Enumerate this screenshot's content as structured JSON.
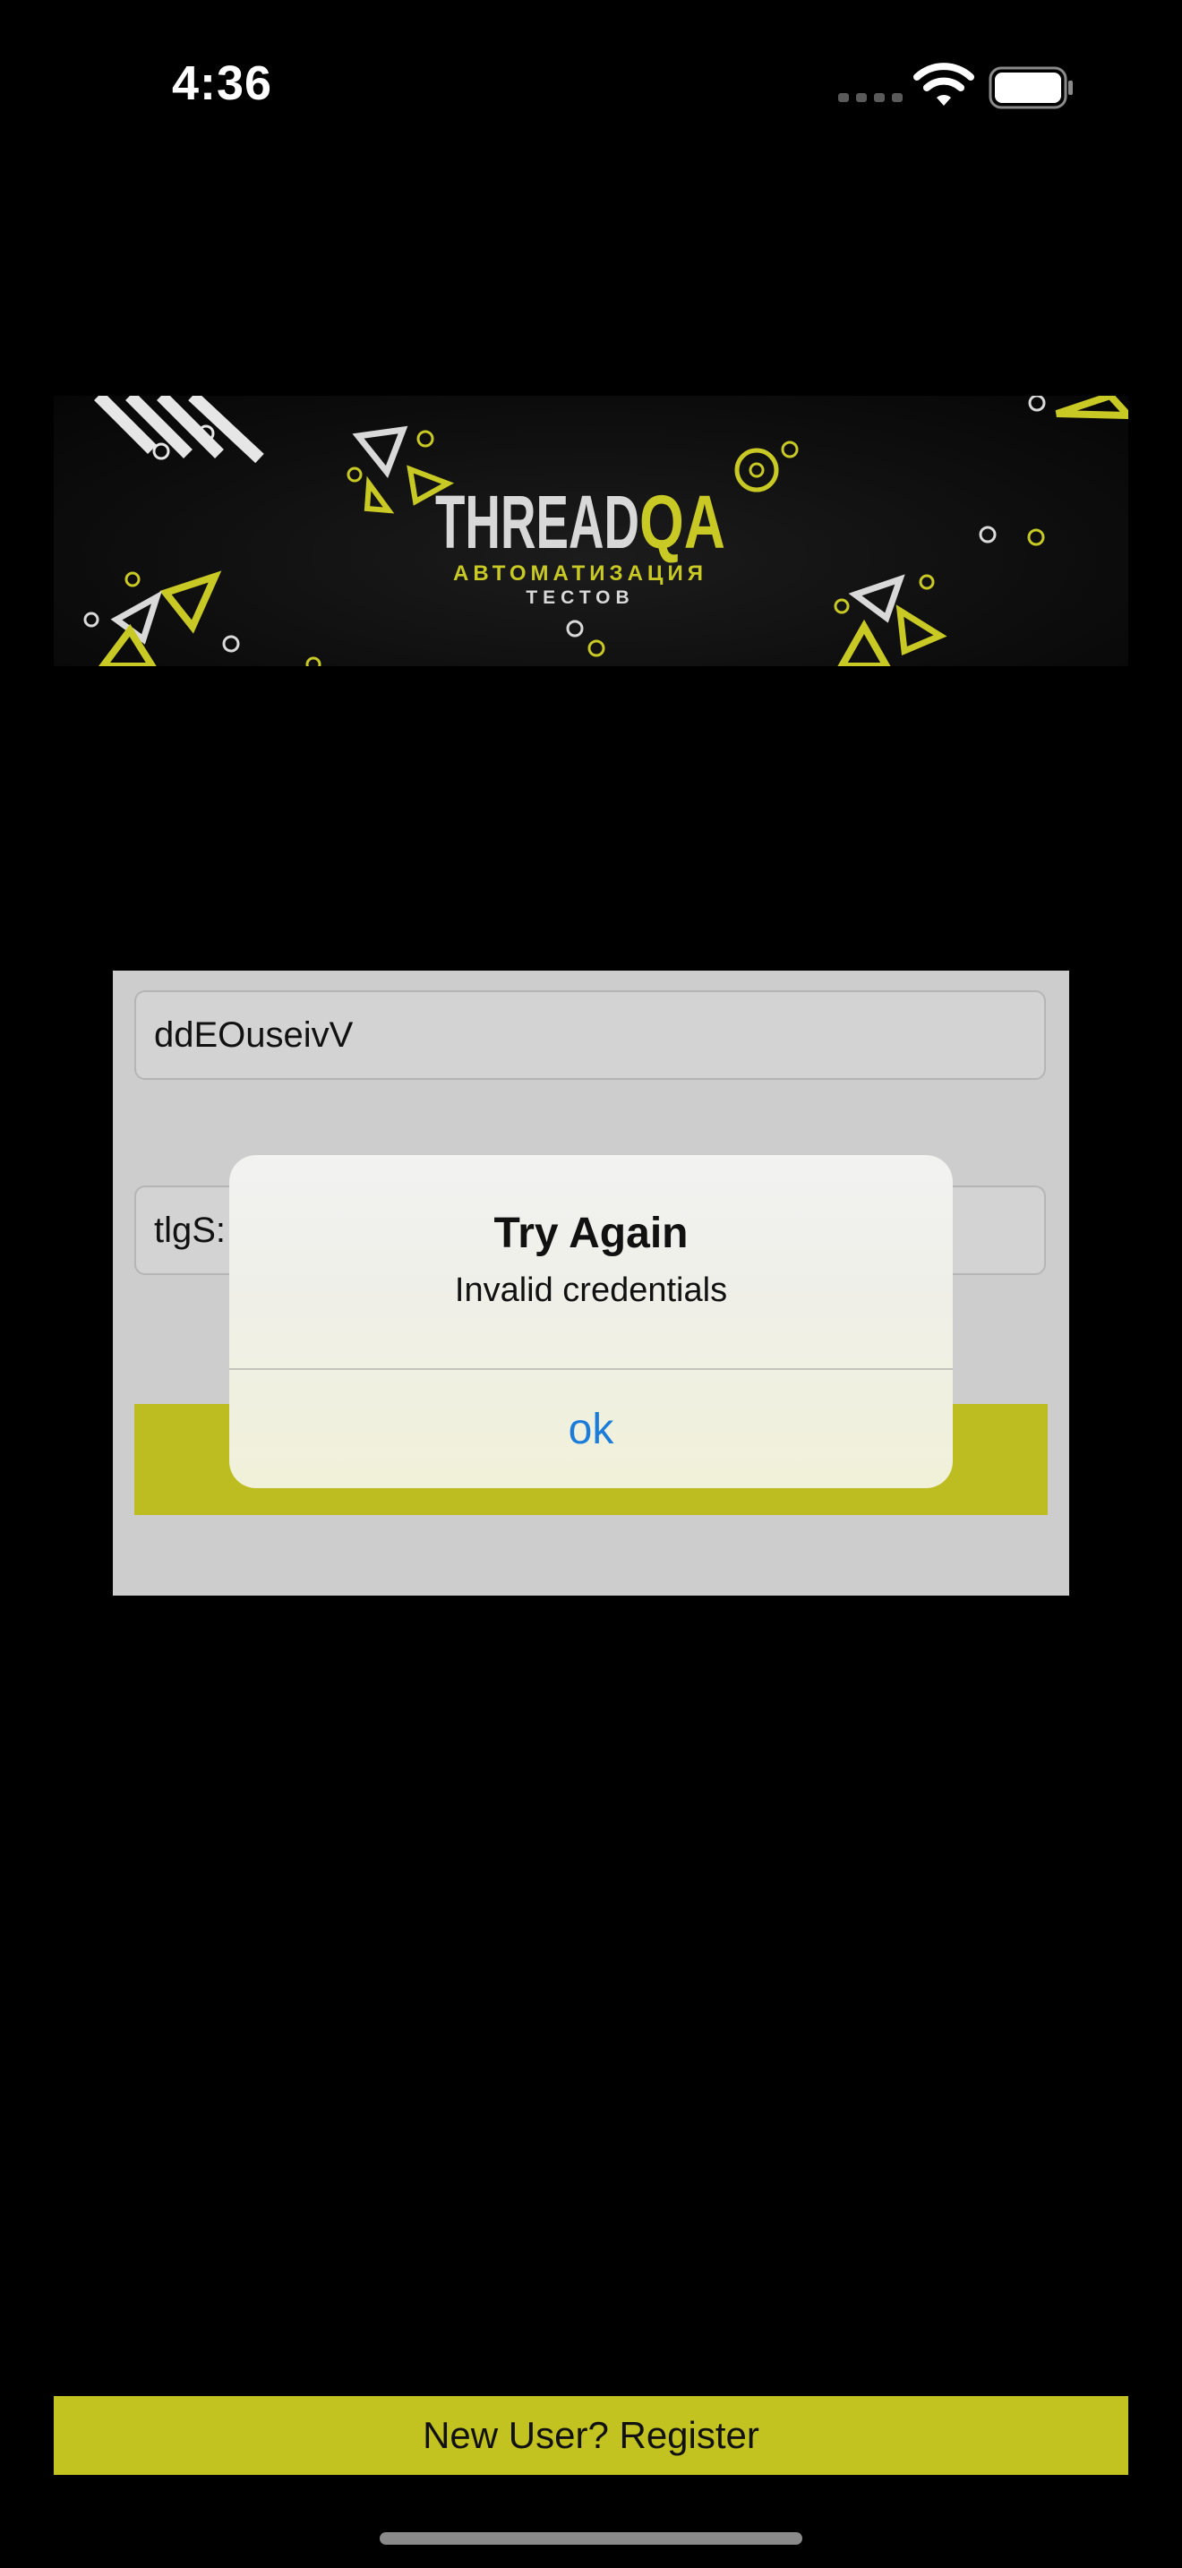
{
  "status_bar": {
    "time": "4:36",
    "icons": [
      "signal-icon",
      "wifi-icon",
      "battery-icon"
    ]
  },
  "banner": {
    "brand_part1": "THREAD",
    "brand_part2": "QA",
    "tagline_line1": "АВТОМАТИЗАЦИЯ",
    "tagline_line2": "ТЕСТОВ"
  },
  "login": {
    "username_value": "ddEOuseivV",
    "password_value": "tlgS:"
  },
  "alert": {
    "title": "Try Again",
    "message": "Invalid credentials",
    "ok_label": "ok"
  },
  "register": {
    "label": "New User? Register"
  },
  "colors": {
    "accent": "#c2c221",
    "alert_link": "#1b7cd9",
    "background": "#000000",
    "card": "#cdcdcd"
  }
}
